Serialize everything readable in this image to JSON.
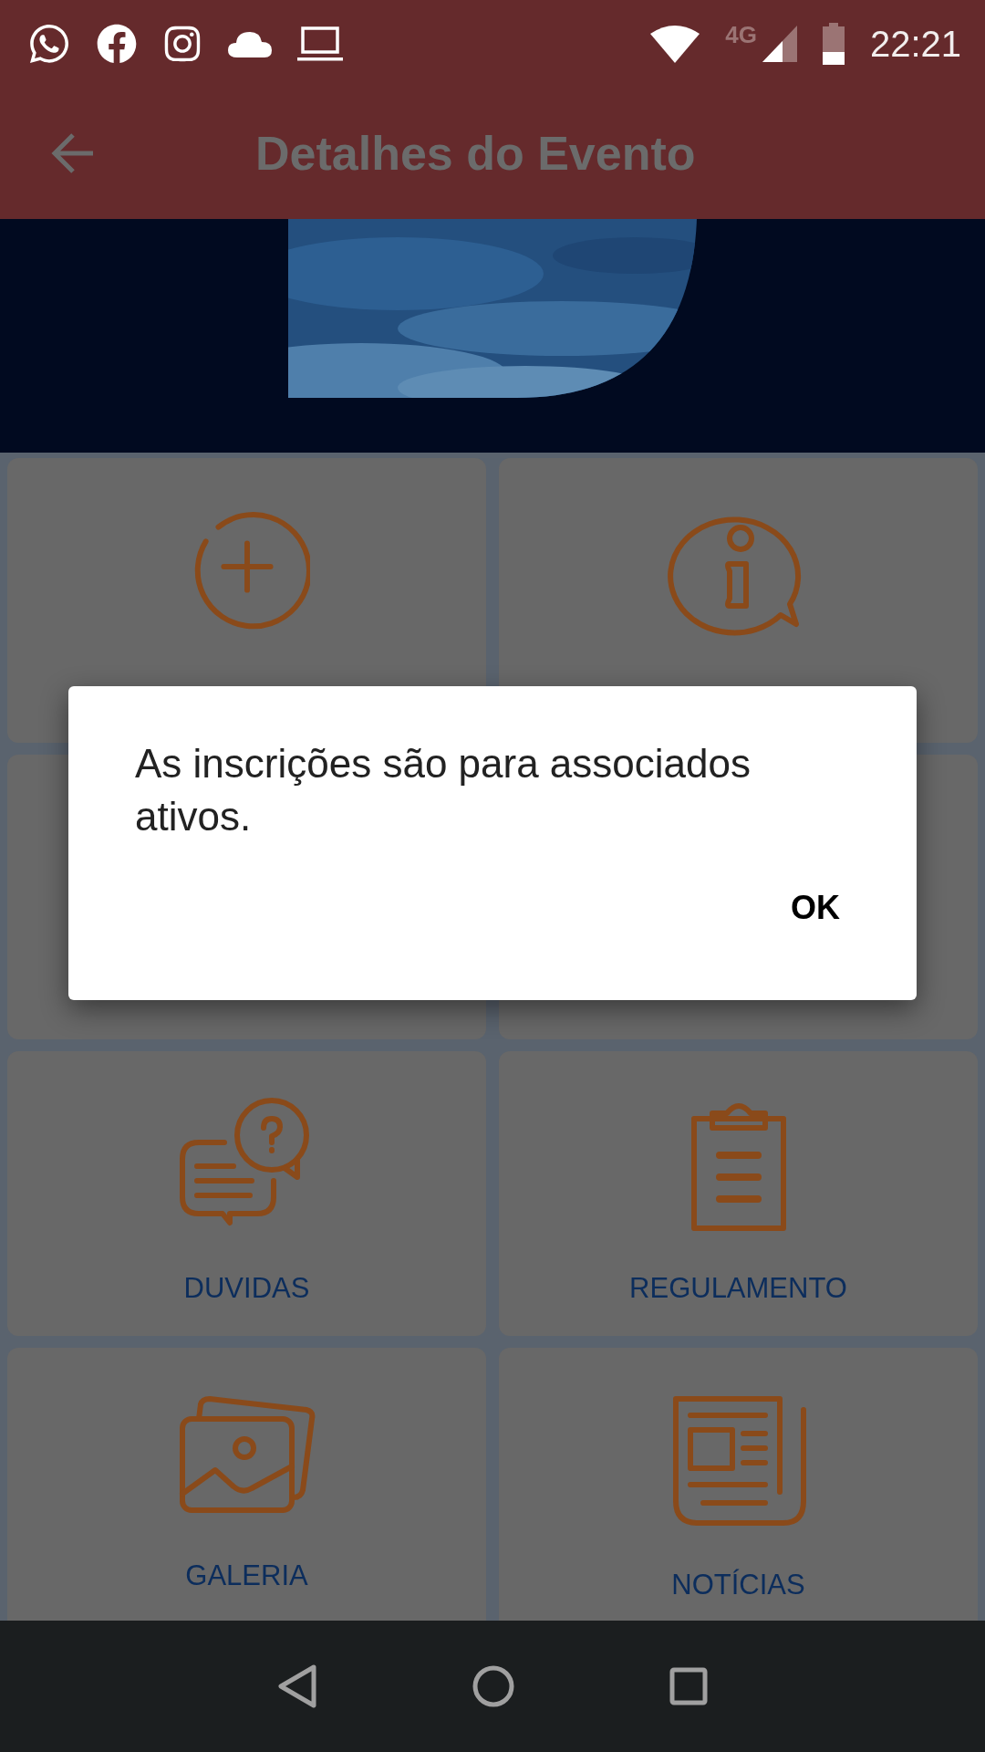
{
  "status_bar": {
    "network": "4G",
    "time": "22:21"
  },
  "app_bar": {
    "title": "Detalhes do Evento"
  },
  "menu": [
    {
      "kind": "plus"
    },
    {
      "kind": "info"
    },
    {
      "kind": "covered"
    },
    {
      "kind": "covered"
    },
    {
      "kind": "chat",
      "label": "DUVIDAS"
    },
    {
      "kind": "clipboard",
      "label": "REGULAMENTO"
    },
    {
      "kind": "gallery",
      "label": "GALERIA"
    },
    {
      "kind": "news",
      "label": "NOTÍCIAS"
    }
  ],
  "dialog": {
    "message": "As inscrições são para associados ativos.",
    "buttons": [
      "OK"
    ]
  }
}
